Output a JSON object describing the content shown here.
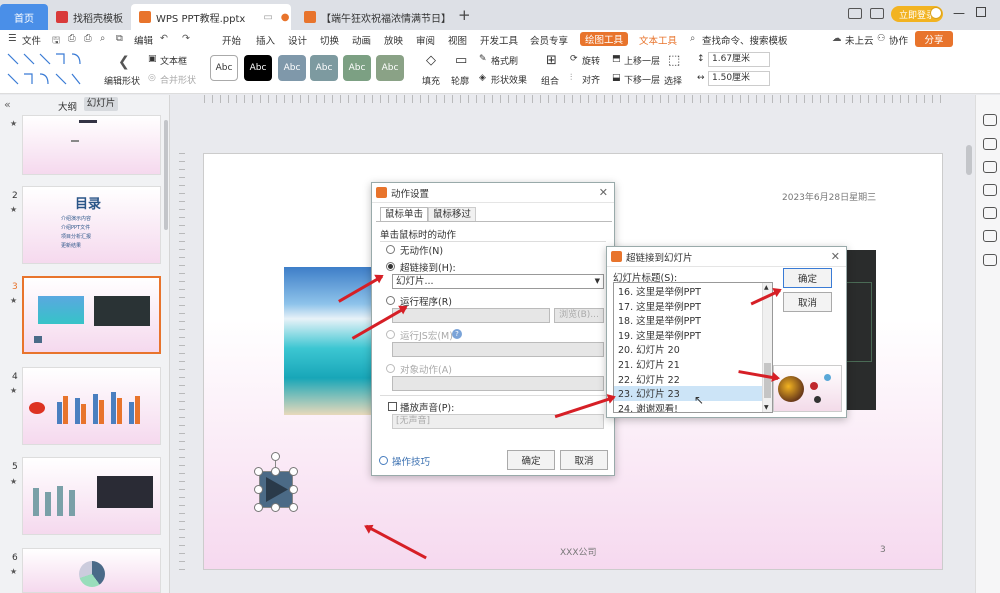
{
  "titlebar": {
    "home_tab": "首页",
    "tabs": [
      "找稻壳模板",
      "WPS PPT教程.pptx",
      "【端午狂欢祝福浓情满节日】"
    ],
    "new_tab": "+",
    "login": "立即登录"
  },
  "menubar": {
    "file": "文件",
    "edit": "编辑",
    "items": [
      "开始",
      "插入",
      "设计",
      "切换",
      "动画",
      "放映",
      "审阅",
      "视图",
      "开发工具",
      "会员专享"
    ],
    "drawing_tools": "绘图工具",
    "text_tools": "文本工具",
    "search": "查找命令、搜索模板",
    "cloud": "未上云",
    "collab": "协作",
    "share": "分享"
  },
  "ribbon": {
    "edit_shape": "编辑形状",
    "textbox": "文本框",
    "merge_shape": "合并形状",
    "style_label": "Abc",
    "fill": "填充",
    "outline": "轮廓",
    "format_brush": "格式刷",
    "shape_effect": "形状效果",
    "group": "组合",
    "rotate": "旋转",
    "align": "对齐",
    "up_one": "上移一层",
    "down_one": "下移一层",
    "select": "选择",
    "height": "1.67厘米",
    "width": "1.50厘米"
  },
  "leftpanel": {
    "tab_outline": "大纲",
    "tab_slides": "幻灯片",
    "slide_numbers": [
      "2",
      "3",
      "4",
      "5",
      "6"
    ],
    "toc_title": "目录",
    "toc_items": [
      "介绍演示内容",
      "介绍PPT文件",
      "项目分析汇报",
      "更新结果"
    ]
  },
  "slide": {
    "date": "2023年6月28日星期三",
    "company": "XXX公司",
    "page": "3"
  },
  "action_dialog": {
    "title": "动作设置",
    "tab_click": "鼠标单击",
    "tab_hover": "鼠标移过",
    "section": "单击鼠标时的动作",
    "none": "无动作(N)",
    "hyperlink": "超链接到(H):",
    "hyperlink_value": "幻灯片...",
    "run_program": "运行程序(R)",
    "browse": "浏览(B)...",
    "run_macro": "运行JS宏(M)",
    "object_action": "对象动作(A)",
    "play_sound": "播放声音(P):",
    "sound_value": "[无声音]",
    "tips": "操作技巧",
    "ok": "确定",
    "cancel": "取消"
  },
  "link_dialog": {
    "title": "超链接到幻灯片",
    "list_label": "幻灯片标题(S):",
    "items": [
      "16. 这里是举例PPT",
      "17. 这里是举例PPT",
      "18. 这里是举例PPT",
      "19. 这里是举例PPT",
      "20. 幻灯片 20",
      "21. 幻灯片 21",
      "22. 幻灯片 22",
      "23. 幻灯片 23",
      "24. 谢谢观看!"
    ],
    "selected_index": 7,
    "ok": "确定",
    "cancel": "取消"
  },
  "colors": {
    "accent": "#e8742c",
    "selected": "#cce4f7",
    "arrow": "#d61f26"
  }
}
